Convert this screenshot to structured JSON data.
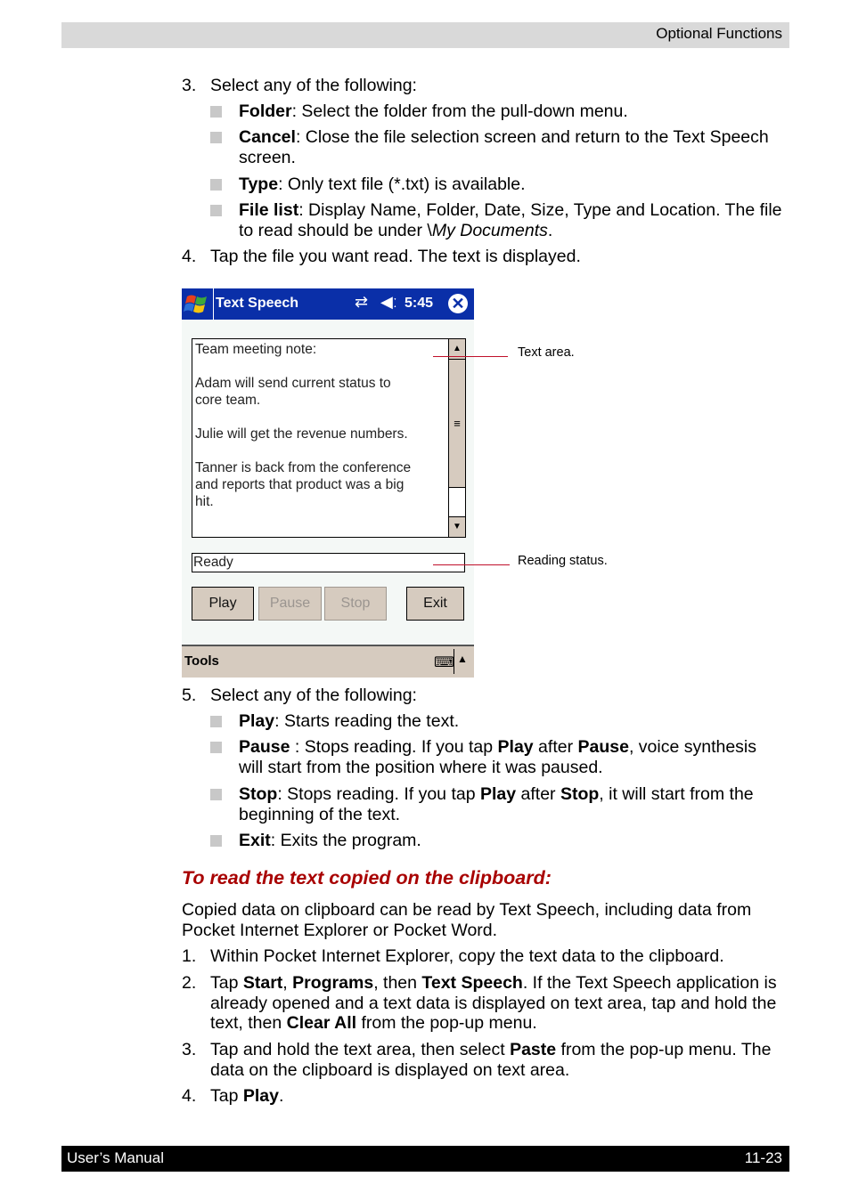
{
  "header": {
    "section": "Optional Functions"
  },
  "footer": {
    "left": "User’s Manual",
    "right": "11-23"
  },
  "step3": {
    "num": "3.",
    "text": "Select any of the following:",
    "items": [
      {
        "term": "Folder",
        "desc": ": Select the folder from the pull-down menu."
      },
      {
        "term": "Cancel",
        "desc": ": Close the file selection screen and return to the Text Speech screen."
      },
      {
        "term": "Type",
        "desc": ": Only text file (*.txt) is available."
      },
      {
        "term": "File list",
        "desc": ": Display Name, Folder, Date, Size, Type and Location. The file to read should be under \\",
        "desc_italic": "My Documents",
        "desc_end": "."
      }
    ]
  },
  "step4": {
    "num": "4.",
    "text": "Tap the file you want read. The text is displayed."
  },
  "screen": {
    "app_title": "Text Speech",
    "connectivity_icon": "connectivity-icon",
    "volume_icon": "speaker-icon",
    "time": "5:45",
    "close_glyph": "✕",
    "text_area_content": "Team meeting note:\n\nAdam will send current status to\ncore team.\n\nJulie will get the revenue numbers.\n\nTanner is back from the conference\nand reports that product was a big\nhit.",
    "status": "Ready",
    "buttons": {
      "play": "Play",
      "pause": "Pause",
      "stop": "Stop",
      "exit": "Exit"
    },
    "menu": {
      "tools": "Tools"
    },
    "callouts": {
      "text_area": "Text area.",
      "reading_status": "Reading status."
    }
  },
  "step5": {
    "num": "5.",
    "text": "Select any of the following:",
    "items": [
      {
        "term": "Play",
        "desc": ": Starts reading the text."
      },
      {
        "term": "Pause",
        "desc1": " : Stops reading. If you tap ",
        "b1": "Play",
        "desc2": " after ",
        "b2": "Pause",
        "desc3": ", voice synthesis will start from the position where it was paused."
      },
      {
        "term": "Stop",
        "desc1": ": Stops reading. If you tap ",
        "b1": "Play",
        "desc2": " after ",
        "b2": "Stop",
        "desc3": ", it will start from the beginning of the text."
      },
      {
        "term": "Exit",
        "desc": ": Exits the program."
      }
    ]
  },
  "clipboard": {
    "title": "To read the text copied on the clipboard:",
    "intro": "Copied data on clipboard can be read by Text Speech, including data from Pocket Internet Explorer or Pocket Word.",
    "steps": [
      {
        "num": "1.",
        "text": "Within Pocket Internet Explorer, copy the text data to the clipboard."
      },
      {
        "num": "2.",
        "t1": "Tap ",
        "b1": "Start",
        "t2": ", ",
        "b2": "Programs",
        "t3": ", then ",
        "b3": "Text Speech",
        "t4": ". If the Text Speech application is already opened and a text data is displayed on text area, tap and hold the text, then ",
        "b4": "Clear All",
        "t5": " from the pop-up menu."
      },
      {
        "num": "3.",
        "t1": "Tap and hold the text area, then select ",
        "b1": "Paste",
        "t2": " from the pop-up menu. The data on the clipboard is displayed on text area."
      },
      {
        "num": "4.",
        "t1": "Tap ",
        "b1": "Play",
        "t2": "."
      }
    ]
  }
}
